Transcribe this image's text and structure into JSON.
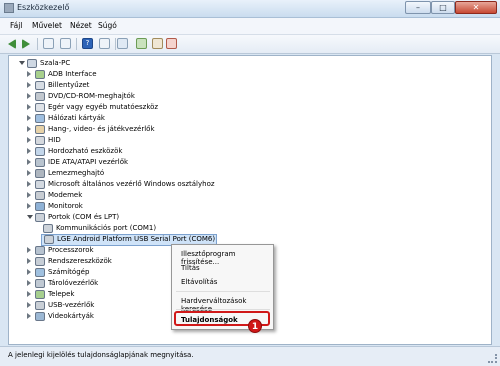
{
  "window": {
    "title": "Eszközkezelő",
    "controls": {
      "minimize": "–",
      "maximize": "□",
      "close": "✕"
    }
  },
  "menu": [
    "Fájl",
    "Művelet",
    "Nézet",
    "Súgó"
  ],
  "toolbar": {
    "icons": [
      "back-icon",
      "forward-icon",
      "properties-icon",
      "view-icon",
      "help-icon",
      "resource-icon",
      "scan-hardware-icon",
      "update-driver-icon",
      "disable-icon",
      "uninstall-icon"
    ],
    "help_glyph": "?"
  },
  "tree": {
    "root": "Szala-PC",
    "items": [
      "ADB Interface",
      "Billentyűzet",
      "DVD/CD-ROM-meghajtók",
      "Egér vagy egyéb mutatóeszköz",
      "Hálózati kártyák",
      "Hang-, video- és játékvezérlők",
      "HID",
      "Hordozható eszközök",
      "IDE ATA/ATAPI vezérlők",
      "Lemezmeghajtó",
      "Microsoft általános vezérlő Windows osztályhoz",
      "Modemek",
      "Monitorok",
      "Portok (COM és LPT)",
      "Kommunikációs port (COM1)",
      "LGE Android Platform USB Serial Port (COM6)",
      "Processzorok",
      "Rendszereszközök",
      "Számítógép",
      "Tárolóvezérlők",
      "Telepek",
      "USB-vezérlők",
      "Videokártyák"
    ]
  },
  "context_menu": {
    "items": [
      "Illesztőprogram frissítése...",
      "Tiltás",
      "Eltávolítás",
      "Hardverváltozások keresése",
      "Tulajdonságok"
    ],
    "badge": "1",
    "highlight_color": "#d01818"
  },
  "status": {
    "text": "A jelenlegi kijelölés tulajdonságlapjának megnyitása."
  },
  "colors": {
    "selection": "#cfe3f8",
    "accent": "#d01818"
  }
}
